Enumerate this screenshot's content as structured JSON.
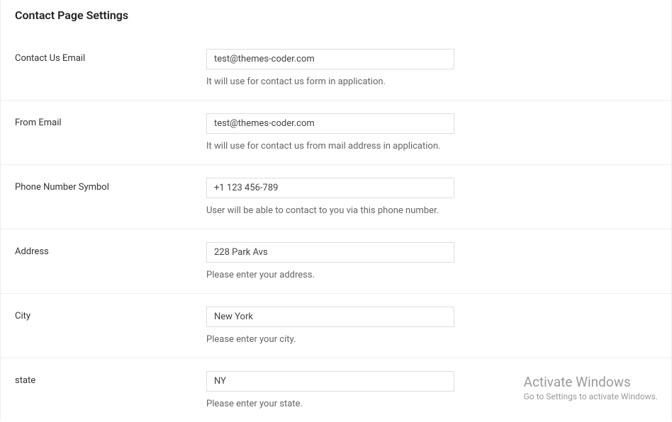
{
  "page": {
    "title": "Contact Page Settings"
  },
  "fields": {
    "contact_email": {
      "label": "Contact Us Email",
      "value": "test@themes-coder.com",
      "help": "It will use for contact us form in application."
    },
    "from_email": {
      "label": "From Email",
      "value": "test@themes-coder.com",
      "help": "It will use for contact us from mail address in application."
    },
    "phone": {
      "label": "Phone Number Symbol",
      "value": "+1 123 456-789",
      "help": "User will be able to contact to you via this phone number."
    },
    "address": {
      "label": "Address",
      "value": "228 Park Avs",
      "help": "Please enter your address."
    },
    "city": {
      "label": "City",
      "value": "New York",
      "help": "Please enter your city."
    },
    "state": {
      "label": "state",
      "value": "NY",
      "help": "Please enter your state."
    }
  },
  "watermark": {
    "title": "Activate Windows",
    "subtitle": "Go to Settings to activate Windows."
  }
}
